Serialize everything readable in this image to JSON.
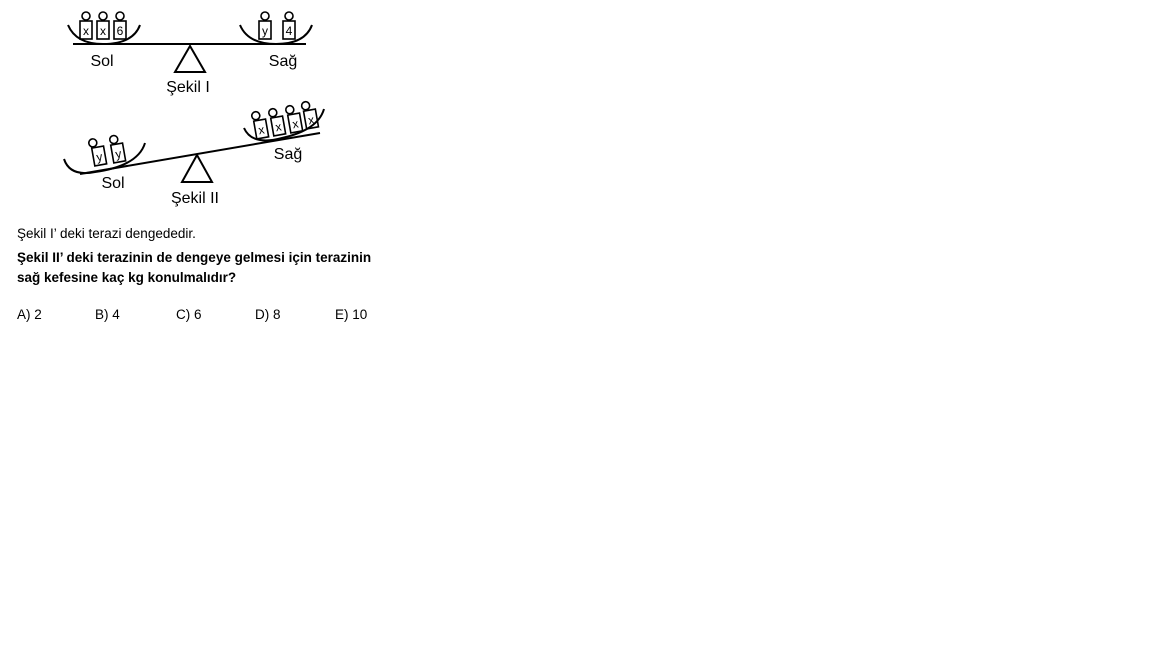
{
  "figure1": {
    "left_pan_label": "Sol",
    "right_pan_label": "Sağ",
    "caption": "Şekil I",
    "left_weights": [
      "x",
      "x",
      "6"
    ],
    "right_weights": [
      "y",
      "4"
    ]
  },
  "figure2": {
    "left_pan_label": "Sol",
    "right_pan_label": "Sağ",
    "caption": "Şekil II",
    "left_weights": [
      "y",
      "y"
    ],
    "right_weights": [
      "x",
      "x",
      "x",
      "x"
    ]
  },
  "question": {
    "intro": "Şekil I’ deki terazi dengededir.",
    "line1": "Şekil II’ deki terazinin de dengeye gelmesi için terazinin",
    "line2": "sağ kefesine kaç kg konulmalıdır?"
  },
  "choices": [
    "A) 2",
    "B) 4",
    "C) 6",
    "D) 8",
    "E) 10"
  ]
}
